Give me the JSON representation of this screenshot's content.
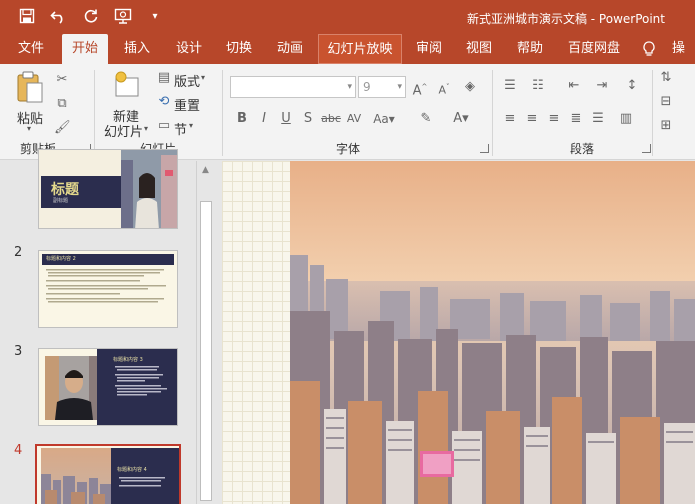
{
  "window": {
    "title": "新式亚洲城市演示文稿 - PowerPoint"
  },
  "qat": {
    "save_icon": "save-icon",
    "undo_icon": "undo-icon",
    "redo_icon": "redo-icon",
    "present_icon": "present-icon",
    "customize_icon": "customize-qat-icon"
  },
  "tabs": [
    {
      "label": "文件"
    },
    {
      "label": "开始"
    },
    {
      "label": "插入"
    },
    {
      "label": "设计"
    },
    {
      "label": "切换"
    },
    {
      "label": "动画"
    },
    {
      "label": "幻灯片放映"
    },
    {
      "label": "审阅"
    },
    {
      "label": "视图"
    },
    {
      "label": "帮助"
    },
    {
      "label": "百度网盘"
    },
    {
      "label": "操作"
    }
  ],
  "ribbon": {
    "clipboard": {
      "label": "剪贴板",
      "paste_label": "粘贴"
    },
    "slides": {
      "label": "幻灯片",
      "new_slide_line1": "新建",
      "new_slide_line2": "幻灯片",
      "layout_label": "版式",
      "reset_label": "重置",
      "section_label": "节"
    },
    "font": {
      "label": "字体",
      "font_name_value": "",
      "font_size_value": "9"
    },
    "paragraph": {
      "label": "段落"
    }
  },
  "slides": [
    {
      "number": "",
      "title": "标题",
      "subtitle": "副标题"
    },
    {
      "number": "2",
      "heading": "标题和内容 2"
    },
    {
      "number": "3",
      "heading": "标题和内容 3"
    },
    {
      "number": "4",
      "heading": "标题和内容 4"
    }
  ],
  "colors": {
    "accent": "#b7472a",
    "active_slide": "#c0392b",
    "navy": "#2b2d4e"
  }
}
